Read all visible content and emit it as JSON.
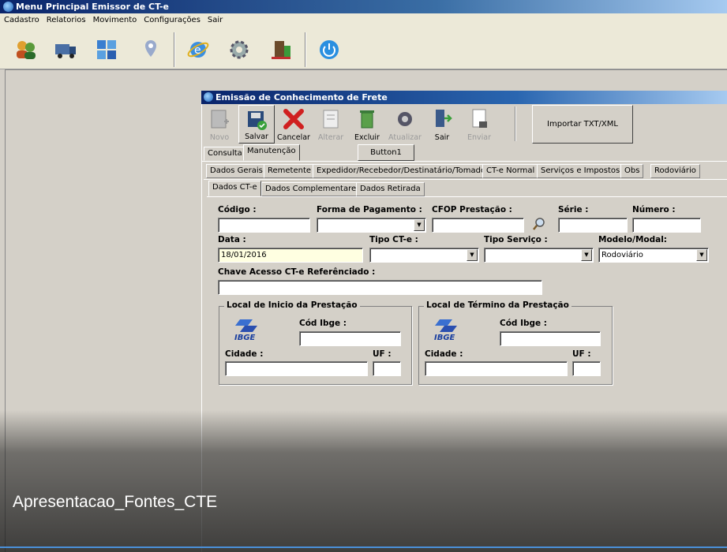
{
  "app": {
    "title": "Menu Principal Emissor de CT-e"
  },
  "menu": [
    "Cadastro",
    "Relatorios",
    "Movimento",
    "Configurações",
    "Sair"
  ],
  "toolbar_icons": [
    "users-icon",
    "truck-icon",
    "puzzle-icon",
    "map-pin-icon",
    "internet-explorer-icon",
    "gear-icon",
    "door-exit-icon",
    "power-icon"
  ],
  "child": {
    "title": "Emissão de Conhecimento de Frete",
    "buttons": [
      {
        "label": "Novo",
        "enabled": false
      },
      {
        "label": "Salvar",
        "enabled": true
      },
      {
        "label": "Cancelar",
        "enabled": true
      },
      {
        "label": "Alterar",
        "enabled": false
      },
      {
        "label": "Excluir",
        "enabled": true
      },
      {
        "label": "Atualizar",
        "enabled": false
      },
      {
        "label": "Sair",
        "enabled": true
      },
      {
        "label": "Enviar",
        "enabled": false
      }
    ],
    "import_button": "Importar TXT/XML",
    "button1": "Button1",
    "mode_tabs": [
      "Consulta",
      "Manutenção"
    ],
    "main_tabs": [
      "Dados Gerais",
      "Remetente",
      "Expedidor/Recebedor/Destinatário/Tomador",
      "CT-e Normal",
      "Serviços e Impostos",
      "Obs",
      "Rodoviário"
    ],
    "sub_tabs": [
      "Dados CT-e",
      "Dados Complementares",
      "Dados Retirada"
    ],
    "labels": {
      "codigo": "Código :",
      "forma_pagamento": "Forma de Pagamento :",
      "cfop": "CFOP Prestação :",
      "serie": "Série :",
      "numero": "Número :",
      "data": "Data :",
      "tipo_cte": "Tipo CT-e :",
      "tipo_servico": "Tipo Serviço :",
      "modelo_modal": "Modelo/Modal:",
      "chave": "Chave Acesso CT-e Referênciado :"
    },
    "values": {
      "data": "18/01/2016",
      "modelo_modal": "Rodoviário"
    },
    "inicio": {
      "title": "Local de Inicio da Prestação",
      "cod_ibge": "Cód Ibge :",
      "cidade": "Cidade :",
      "uf": "UF :",
      "logo": "IBGE"
    },
    "termino": {
      "title": "Local de Término da Prestação",
      "cod_ibge": "Cód Ibge :",
      "cidade": "Cidade :",
      "uf": "UF :",
      "logo": "IBGE"
    }
  },
  "caption": "Apresentacao_Fontes_CTE"
}
